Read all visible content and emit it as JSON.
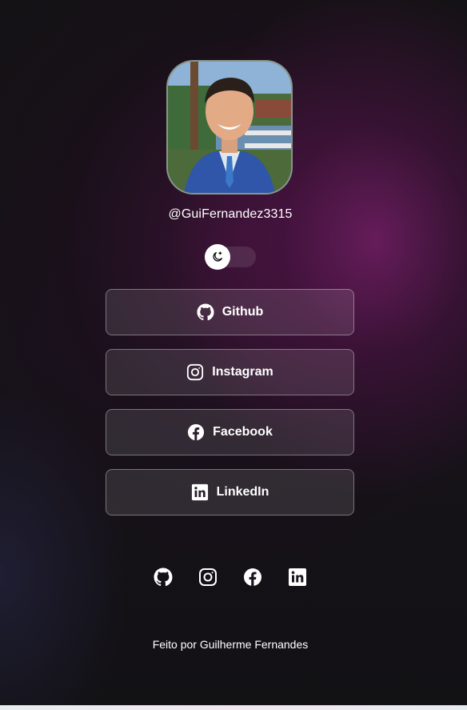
{
  "profile": {
    "username": "@GuiFernandez3315"
  },
  "theme_toggle": {
    "icon": "moon-icon",
    "state": "dark"
  },
  "links": [
    {
      "label": "Github",
      "icon": "github-icon"
    },
    {
      "label": "Instagram",
      "icon": "instagram-icon"
    },
    {
      "label": "Facebook",
      "icon": "facebook-icon"
    },
    {
      "label": "LinkedIn",
      "icon": "linkedin-icon"
    }
  ],
  "social_icons": [
    "github-icon",
    "instagram-icon",
    "facebook-icon",
    "linkedin-icon"
  ],
  "footer": {
    "text": "Feito por Guilherme Fernandes"
  },
  "colors": {
    "accent": "#7d206e",
    "background": "#121114",
    "text": "#ffffff"
  }
}
